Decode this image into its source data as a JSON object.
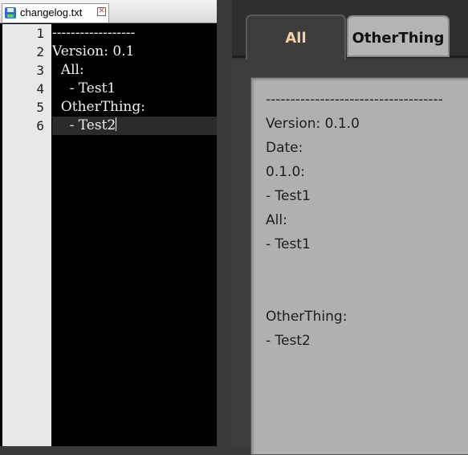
{
  "editor": {
    "tab": {
      "filename": "changelog.txt",
      "close_glyph": "✕",
      "save_icon": "save-icon",
      "close_icon": "close-icon"
    },
    "line_numbers": [
      "1",
      "2",
      "3",
      "4",
      "5",
      "6"
    ],
    "lines": [
      "------------------",
      "Version: 0.1",
      "  All:",
      "    - Test1",
      "  OtherThing:",
      "    - Test2"
    ],
    "current_line": 6
  },
  "app": {
    "tabs": [
      {
        "label": "All",
        "active": true
      },
      {
        "label": "OtherThing",
        "active": false
      }
    ],
    "content": [
      "------------------------------------",
      "Version: 0.1.0",
      "Date:",
      "0.1.0:",
      "- Test1",
      "All:",
      "- Test1",
      "",
      "",
      "OtherThing:",
      "- Test2"
    ],
    "colors": {
      "active_tab_text": "#f2d1a6",
      "inactive_tab_bg": "#b4b4b4",
      "panel_bg": "#b0b0b0"
    }
  }
}
